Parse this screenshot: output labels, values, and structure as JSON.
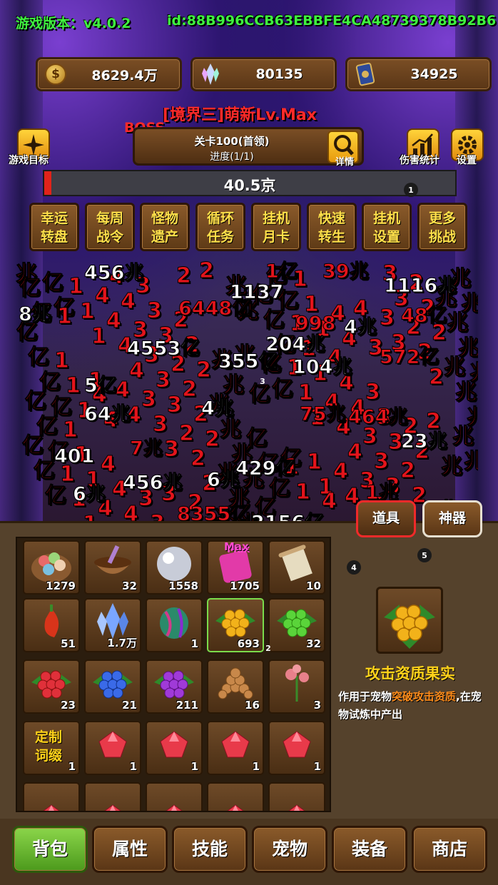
{
  "header": {
    "version_label": "游戏版本：v4.0.2",
    "player_id": "id:88B996CCB63EBBFE4CA48739378B92B6"
  },
  "resources": [
    {
      "icon": "coin-icon",
      "value": "8629.4万"
    },
    {
      "icon": "crystal-icon",
      "value": "80135"
    },
    {
      "icon": "card-icon",
      "value": "34925"
    }
  ],
  "realm_title": "[境界三]萌新Lv.Max",
  "boss_label": "BOSS",
  "stage": {
    "title": "关卡100(首领)",
    "progress": "进度(1/1)",
    "detail_label": "详情"
  },
  "side_buttons": {
    "goal": "游戏目标",
    "damage_stats": "伤害统计",
    "settings": "设置"
  },
  "boss_hp": {
    "text": "40.5京",
    "fraction": 0.017
  },
  "markers": [
    "1",
    "2",
    "3",
    "4",
    "5"
  ],
  "feature_buttons": [
    {
      "line1": "幸运",
      "line2": "转盘"
    },
    {
      "line1": "每周",
      "line2": "战令"
    },
    {
      "line1": "怪物",
      "line2": "遗产"
    },
    {
      "line1": "循环",
      "line2": "任务"
    },
    {
      "line1": "挂机",
      "line2": "月卡"
    },
    {
      "line1": "快速",
      "line2": "转生"
    },
    {
      "line1": "挂机",
      "line2": "设置"
    },
    {
      "line1": "更多",
      "line2": "挑战"
    }
  ],
  "damage_numbers": [
    {
      "text": "456兆",
      "color": "white"
    },
    {
      "text": "1116兆",
      "color": "white"
    },
    {
      "text": "8兆",
      "color": "white"
    },
    {
      "text": "6448亿",
      "color": "red"
    },
    {
      "text": "4553亿",
      "color": "white"
    },
    {
      "text": "204兆",
      "color": "white"
    },
    {
      "text": "355亿",
      "color": "white"
    },
    {
      "text": "572亿",
      "color": "red"
    },
    {
      "text": "5亿",
      "color": "white"
    },
    {
      "text": "64兆",
      "color": "white"
    },
    {
      "text": "4兆",
      "color": "white"
    },
    {
      "text": "75兆",
      "color": "red"
    },
    {
      "text": "464兆",
      "color": "red"
    },
    {
      "text": "401",
      "color": "white"
    },
    {
      "text": "7兆",
      "color": "red"
    },
    {
      "text": "429亿",
      "color": "white"
    },
    {
      "text": "6兆",
      "color": "white"
    },
    {
      "text": "456兆",
      "color": "white"
    },
    {
      "text": "8355亿",
      "color": "red"
    },
    {
      "text": "2156亿",
      "color": "white"
    },
    {
      "text": "1137",
      "color": "white"
    },
    {
      "text": "998",
      "color": "red"
    },
    {
      "text": "4兆",
      "color": "white"
    },
    {
      "text": "1亿",
      "color": "red"
    },
    {
      "text": "23兆",
      "color": "white"
    },
    {
      "text": "6兆",
      "color": "white"
    },
    {
      "text": "1兆",
      "color": "red"
    },
    {
      "text": "39兆",
      "color": "red"
    },
    {
      "text": "48亿",
      "color": "red"
    },
    {
      "text": "104兆",
      "color": "white"
    }
  ],
  "panel_tabs": {
    "items": "道具",
    "artifacts": "神器"
  },
  "inventory": [
    {
      "name": "candy-bowl",
      "count": "1279"
    },
    {
      "name": "mortar-bowl",
      "count": "32"
    },
    {
      "name": "pearl",
      "count": "1558"
    },
    {
      "name": "max-ticket",
      "count": "1705",
      "badge": "Max"
    },
    {
      "name": "scroll",
      "count": "10"
    },
    {
      "name": "red-pepper",
      "count": "51"
    },
    {
      "name": "blue-crystal",
      "count": "1.7万"
    },
    {
      "name": "striped-melon",
      "count": "1"
    },
    {
      "name": "attack-fruit",
      "count": "693"
    },
    {
      "name": "green-fruit",
      "count": "32"
    },
    {
      "name": "red-fruit",
      "count": "23"
    },
    {
      "name": "blue-fruit",
      "count": "21"
    },
    {
      "name": "purple-fruit",
      "count": "211"
    },
    {
      "name": "seed-pile",
      "count": "16"
    },
    {
      "name": "rose",
      "count": "3"
    },
    {
      "name": "custom-affix",
      "count": "1",
      "label": "定制词缀"
    },
    {
      "name": "red-gem",
      "count": "1"
    },
    {
      "name": "red-gem",
      "count": "1"
    },
    {
      "name": "red-gem",
      "count": "1"
    },
    {
      "name": "red-gem",
      "count": "1"
    }
  ],
  "selected_item": {
    "name": "攻击资质果实",
    "desc_part1": "作用于宠物",
    "desc_highlight": "突破攻击资质",
    "desc_part2": ",在宠物试炼中产出"
  },
  "bottom_tabs": [
    "背包",
    "属性",
    "技能",
    "宠物",
    "装备",
    "商店"
  ],
  "colors": {
    "header_green": "#3ff23f",
    "realm_red": "#ff2a2a",
    "feature_text": "#ffe04a",
    "active_tab_green": "#6ac43a",
    "highlight_orange": "#ff8c1a",
    "item_name_yellow": "#ffd21a"
  }
}
